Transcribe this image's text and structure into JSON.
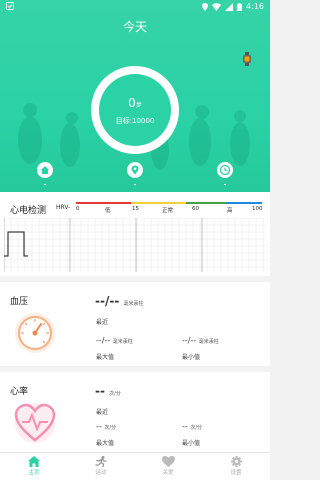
{
  "status_bar": {
    "time": "4:16"
  },
  "header": {
    "title": "今天"
  },
  "steps": {
    "value": "0",
    "unit": "步",
    "goal_label": "目标:10000"
  },
  "hero_buttons": [
    {
      "icon": "home-icon",
      "caption": "-"
    },
    {
      "icon": "location-icon",
      "caption": "-"
    },
    {
      "icon": "clock-icon",
      "caption": "-"
    }
  ],
  "ecg": {
    "title": "心电检测",
    "hrv_label": "HRV-",
    "scale": {
      "t0": "0",
      "low": "低",
      "t15": "15",
      "normal": "正常",
      "t60": "60",
      "high": "高",
      "t100": "100"
    },
    "colors": {
      "red": "#e53935",
      "yellow": "#f4d03f",
      "green": "#43a047",
      "blue": "#1e88e5"
    }
  },
  "blood_pressure": {
    "title": "血压",
    "value": "--/--",
    "unit": "毫米汞柱",
    "recent_label": "最近",
    "max_value": "--/--",
    "max_unit": "毫米汞柱",
    "max_label": "最大值",
    "min_value": "--/--",
    "min_unit": "毫米汞柱",
    "min_label": "最小值"
  },
  "heart_rate": {
    "title": "心率",
    "value": "--",
    "unit": "次/分",
    "recent_label": "最近",
    "max_value": "--",
    "max_unit": "次/分",
    "max_label": "最大值",
    "min_value": "--",
    "min_unit": "次/分",
    "min_label": "最小值"
  },
  "bottom_nav": [
    {
      "label": "主页",
      "icon": "home-icon",
      "active": true
    },
    {
      "label": "运动",
      "icon": "running-icon",
      "active": false
    },
    {
      "label": "关爱",
      "icon": "heart-icon",
      "active": false
    },
    {
      "label": "设置",
      "icon": "gear-icon",
      "active": false
    }
  ],
  "accent_color": "#2ad2a5"
}
